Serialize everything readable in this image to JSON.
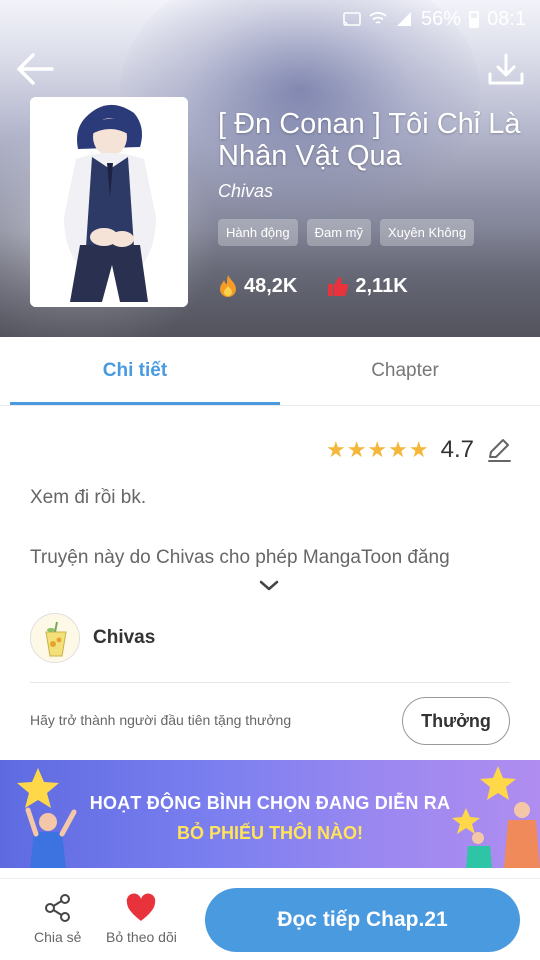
{
  "status_bar": {
    "battery": "56%",
    "time": "08:1"
  },
  "manga": {
    "title": "[ Đn Conan ] Tôi Chỉ Là Nhân Vật Qua",
    "author": "Chivas",
    "tags": [
      "Hành động",
      "Đam mỹ",
      "Xuyên Không"
    ],
    "views": "48,2K",
    "likes": "2,11K"
  },
  "tabs": [
    {
      "label": "Chi tiết",
      "active": true
    },
    {
      "label": "Chapter",
      "active": false
    }
  ],
  "rating": {
    "value": "4.7",
    "stars": 5
  },
  "description": {
    "line1": "Xem đi rồi bk.",
    "line2": "Truyện này do Chivas cho phép MangaToon đăng"
  },
  "author_row": {
    "name": "Chivas"
  },
  "reward": {
    "text": "Hãy trở thành người đầu tiên tặng thưởng",
    "button": "Thưởng"
  },
  "banner": {
    "line1": "HOẠT ĐỘNG BÌNH CHỌN ĐANG DIỄN RA",
    "line2": "BỎ PHIẾU THÔI NÀO!"
  },
  "bottom": {
    "share_label": "Chia sẻ",
    "follow_label": "Bỏ theo dõi",
    "read_button": "Đọc tiếp Chap.21"
  },
  "colors": {
    "accent": "#4a9ae0",
    "star": "#f4b73a",
    "heart": "#e8323c",
    "banner_yellow": "#ffe35a"
  }
}
